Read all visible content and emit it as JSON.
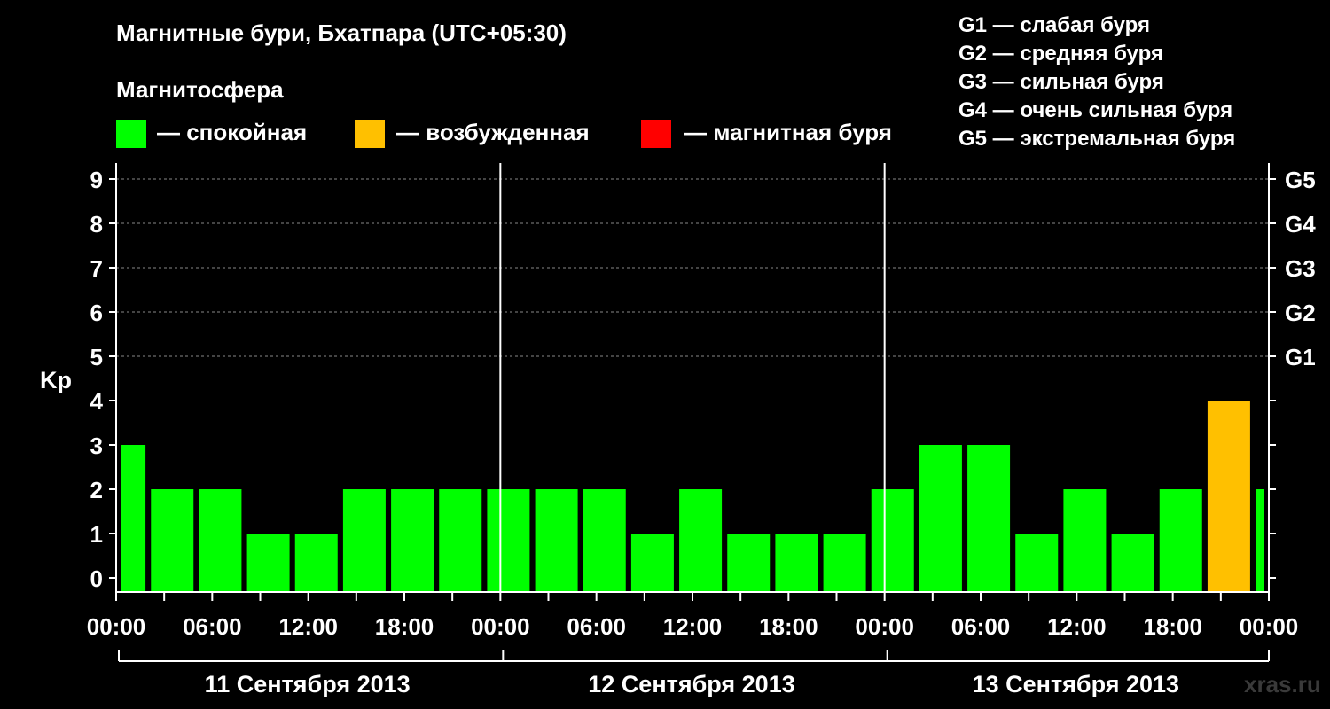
{
  "title": "Магнитные бури, Бхатпара (UTC+05:30)",
  "magnetosphere_heading": "Магнитосфера",
  "legend": [
    {
      "label": "— спокойная",
      "color": "#00ff00"
    },
    {
      "label": "— возбужденная",
      "color": "#ffc000"
    },
    {
      "label": "— магнитная буря",
      "color": "#ff0000"
    }
  ],
  "storm_levels": [
    "G1 — слабая буря",
    "G2 — средняя буря",
    "G3 — сильная буря",
    "G4 — очень сильная буря",
    "G5 — экстремальная буря"
  ],
  "watermark": "xras.ru",
  "chart_data": {
    "type": "bar",
    "ylabel": "Kp",
    "ylim": [
      0,
      9
    ],
    "y_ticks": [
      "0",
      "1",
      "2",
      "3",
      "4",
      "5",
      "6",
      "7",
      "8",
      "9"
    ],
    "y2_ticks": [
      {
        "kp": 5,
        "label": "G1"
      },
      {
        "kp": 6,
        "label": "G2"
      },
      {
        "kp": 7,
        "label": "G3"
      },
      {
        "kp": 8,
        "label": "G4"
      },
      {
        "kp": 9,
        "label": "G5"
      }
    ],
    "x_tick_labels": [
      "00:00",
      "06:00",
      "12:00",
      "18:00",
      "00:00",
      "06:00",
      "12:00",
      "18:00",
      "00:00",
      "06:00",
      "12:00",
      "18:00",
      "00:00"
    ],
    "days": [
      "11 Сентября 2013",
      "12 Сентября 2013",
      "13 Сентября 2013"
    ],
    "grid": "dashed horizontal lines at Kp 5–9",
    "colors": {
      "quiet": "#00ff00",
      "active": "#ffc000",
      "storm": "#ff0000"
    },
    "values": [
      3,
      2,
      2,
      1,
      1,
      2,
      2,
      2,
      2,
      2,
      2,
      1,
      2,
      1,
      1,
      1,
      2,
      3,
      3,
      1,
      2,
      1,
      2,
      4,
      2
    ]
  }
}
